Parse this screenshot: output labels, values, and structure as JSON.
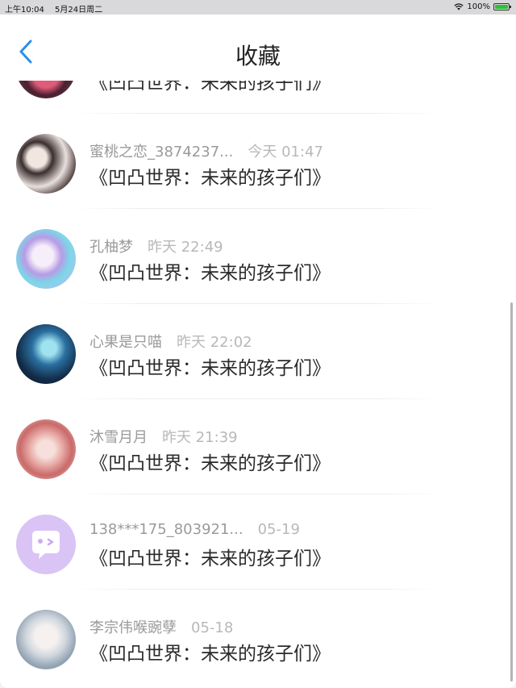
{
  "status_bar": {
    "time": "上午10:04",
    "date": "5月24日周二",
    "battery": "100%"
  },
  "nav": {
    "title": "收藏"
  },
  "items": [
    {
      "name": "",
      "time": "",
      "message": "《凹凸世界：未来的孩子们》"
    },
    {
      "name": "蜜桃之恋_3874237...",
      "time": "今天 01:47",
      "message": "《凹凸世界：未来的孩子们》"
    },
    {
      "name": "孔柚梦",
      "time": "昨天 22:49",
      "message": "《凹凸世界：未来的孩子们》"
    },
    {
      "name": "心果是只喵",
      "time": "昨天 22:02",
      "message": "《凹凸世界：未来的孩子们》"
    },
    {
      "name": "沐雪月月",
      "time": "昨天 21:39",
      "message": "《凹凸世界：未来的孩子们》"
    },
    {
      "name": "138***175_803921...",
      "time": "05-19",
      "message": "《凹凸世界：未来的孩子们》"
    },
    {
      "name": "李宗伟喉豌孽",
      "time": "05-18",
      "message": "《凹凸世界：未来的孩子们》"
    }
  ],
  "colors": {
    "accent": "#2d8fe8",
    "placeholder_avatar": "#d9c4f5"
  }
}
